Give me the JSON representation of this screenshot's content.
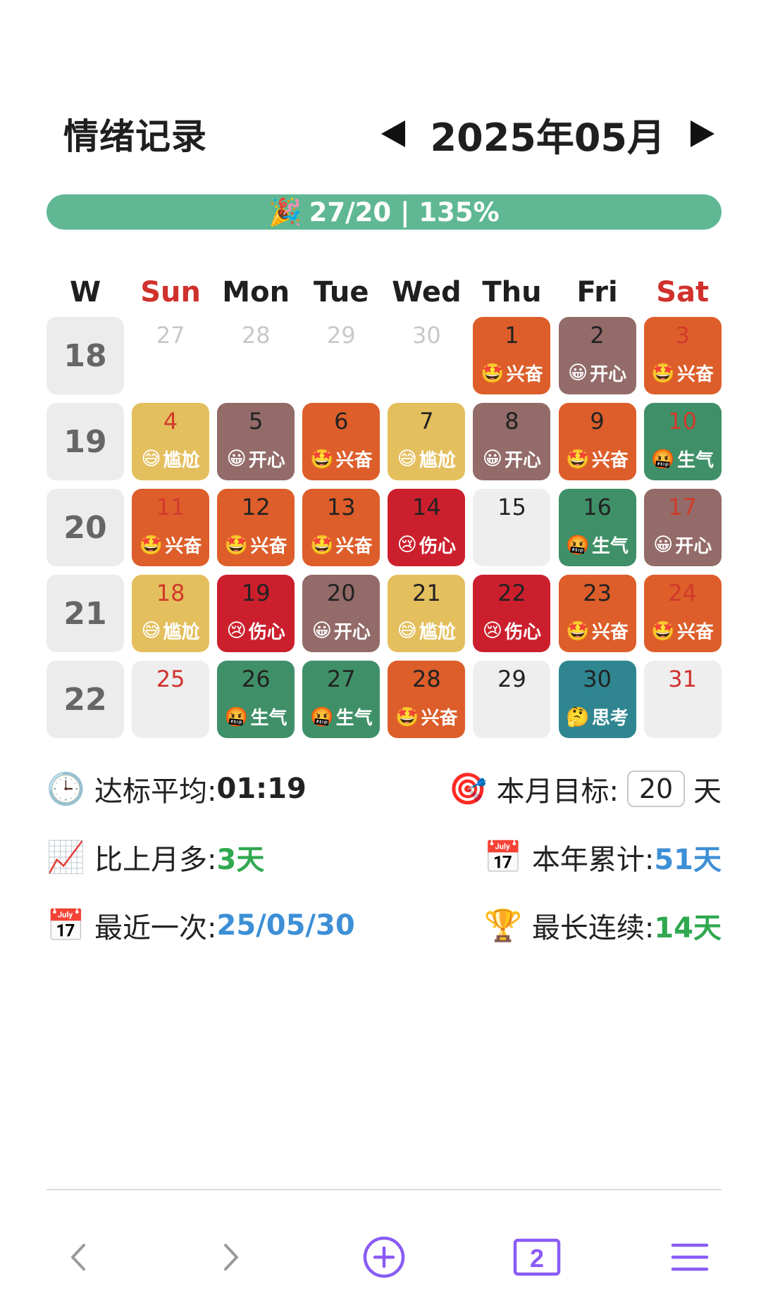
{
  "header": {
    "title": "情绪记录",
    "month": "2025年05月"
  },
  "progress": {
    "emoji": "🎉",
    "label": "27/20 | 135%",
    "fraction": 1.0
  },
  "calendar": {
    "week_col_label": "W",
    "weekdays": [
      "Sun",
      "Mon",
      "Tue",
      "Wed",
      "Thu",
      "Fri",
      "Sat"
    ],
    "weeks": [
      {
        "num": "18",
        "days": [
          {
            "d": "27",
            "out": true
          },
          {
            "d": "28",
            "out": true
          },
          {
            "d": "29",
            "out": true
          },
          {
            "d": "30",
            "out": true
          },
          {
            "d": "1",
            "mood": "excited"
          },
          {
            "d": "2",
            "mood": "happy"
          },
          {
            "d": "3",
            "mood": "excited"
          }
        ]
      },
      {
        "num": "19",
        "days": [
          {
            "d": "4",
            "mood": "awkward"
          },
          {
            "d": "5",
            "mood": "happy"
          },
          {
            "d": "6",
            "mood": "excited"
          },
          {
            "d": "7",
            "mood": "awkward"
          },
          {
            "d": "8",
            "mood": "happy"
          },
          {
            "d": "9",
            "mood": "excited"
          },
          {
            "d": "10",
            "mood": "angry"
          }
        ]
      },
      {
        "num": "20",
        "days": [
          {
            "d": "11",
            "mood": "excited"
          },
          {
            "d": "12",
            "mood": "excited"
          },
          {
            "d": "13",
            "mood": "excited"
          },
          {
            "d": "14",
            "mood": "sad"
          },
          {
            "d": "15"
          },
          {
            "d": "16",
            "mood": "angry"
          },
          {
            "d": "17",
            "mood": "happy"
          }
        ]
      },
      {
        "num": "21",
        "days": [
          {
            "d": "18",
            "mood": "awkward"
          },
          {
            "d": "19",
            "mood": "sad"
          },
          {
            "d": "20",
            "mood": "happy"
          },
          {
            "d": "21",
            "mood": "awkward"
          },
          {
            "d": "22",
            "mood": "sad"
          },
          {
            "d": "23",
            "mood": "excited"
          },
          {
            "d": "24",
            "mood": "excited"
          }
        ]
      },
      {
        "num": "22",
        "days": [
          {
            "d": "25"
          },
          {
            "d": "26",
            "mood": "angry"
          },
          {
            "d": "27",
            "mood": "angry"
          },
          {
            "d": "28",
            "mood": "excited"
          },
          {
            "d": "29"
          },
          {
            "d": "30",
            "mood": "thinking"
          },
          {
            "d": "31"
          }
        ]
      }
    ]
  },
  "moods": {
    "excited": {
      "label": "兴奋",
      "emoji": "🤩",
      "color": "#dd5e2a"
    },
    "happy": {
      "label": "开心",
      "emoji": "😀",
      "color": "#936b69"
    },
    "awkward": {
      "label": "尴尬",
      "emoji": "😅",
      "color": "#e4bf5e"
    },
    "angry": {
      "label": "生气",
      "emoji": "🤬",
      "color": "#3f9068"
    },
    "sad": {
      "label": "伤心",
      "emoji": "😢",
      "color": "#cc1f2d"
    },
    "thinking": {
      "label": "思考",
      "emoji": "🤔",
      "color": "#2f8690"
    }
  },
  "stats": {
    "avg": {
      "icon": "🕒",
      "label": "达标平均: ",
      "value": "01:19"
    },
    "goal": {
      "icon": "🎯",
      "label": "本月目标: ",
      "value": "20",
      "unit": "天"
    },
    "vs_last": {
      "icon": "📈",
      "label": "比上月多: ",
      "value": "3天"
    },
    "year": {
      "icon": "📅",
      "label": "本年累计: ",
      "value": "51天"
    },
    "recent": {
      "icon": "📅",
      "label": "最近一次: ",
      "value": "25/05/30"
    },
    "streak": {
      "icon": "🏆",
      "label": "最长连续: ",
      "value": "14天"
    }
  },
  "toolbar": {
    "back_icon": "back-chevron-icon",
    "forward_icon": "forward-chevron-icon",
    "add_icon": "add-circle-icon",
    "tabs_count": "2",
    "menu_icon": "menu-icon",
    "accent": "#8a5cf5",
    "disabled": "#9a9a9a"
  }
}
